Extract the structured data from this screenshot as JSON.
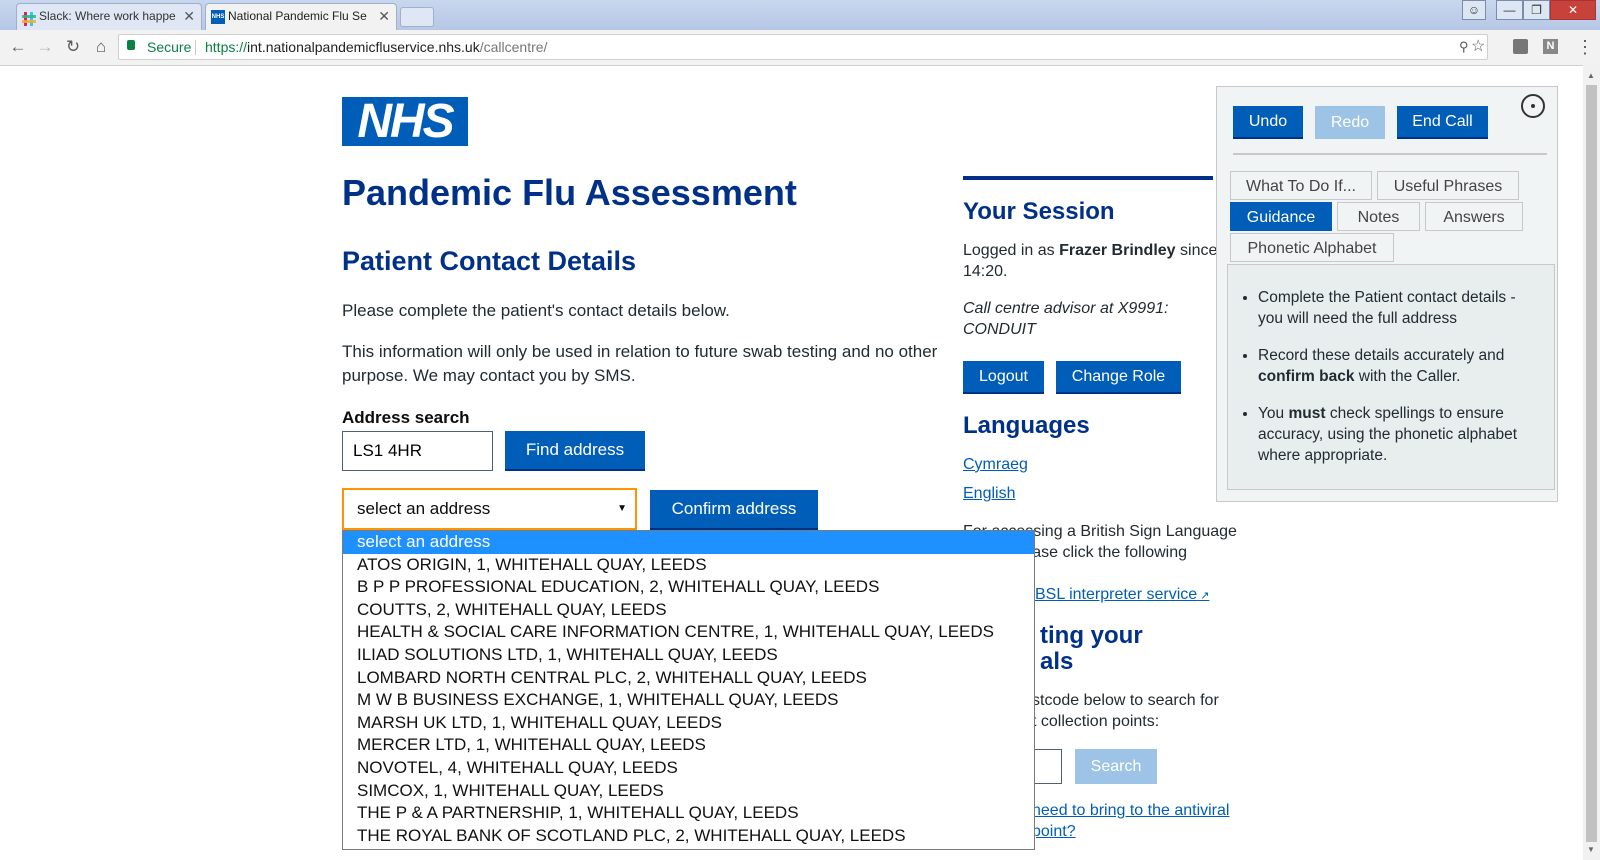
{
  "browser": {
    "tabs": [
      {
        "title": "Slack: Where work happe",
        "active": false
      },
      {
        "title": "National Pandemic Flu Se",
        "active": true
      }
    ],
    "secure_label": "Secure",
    "url_prefix": "https://",
    "url_host": "int.nationalpandemicfluservice.nhs.uk",
    "url_path": "/callcentre/",
    "ext_icon_letter": "N"
  },
  "page": {
    "logo_text": "NHS",
    "title": "Pandemic Flu Assessment",
    "section_title": "Patient Contact Details",
    "intro": "Please complete the patient's contact details below.",
    "info": "This information will only be used in relation to future swab testing and no other purpose. We may contact you by SMS.",
    "address_search_label": "Address search",
    "postcode_value": "LS1 4HR",
    "find_address_label": "Find address",
    "select_value": "select an address",
    "confirm_address_label": "Confirm address",
    "address_options": [
      "select an address",
      "ATOS ORIGIN, 1, WHITEHALL QUAY, LEEDS",
      "B P P PROFESSIONAL EDUCATION, 2, WHITEHALL QUAY, LEEDS",
      "COUTTS, 2, WHITEHALL QUAY, LEEDS",
      "HEALTH & SOCIAL CARE INFORMATION CENTRE, 1, WHITEHALL QUAY, LEEDS",
      "ILIAD SOLUTIONS LTD, 1, WHITEHALL QUAY, LEEDS",
      "LOMBARD NORTH CENTRAL PLC, 2, WHITEHALL QUAY, LEEDS",
      "M W B BUSINESS EXCHANGE, 1, WHITEHALL QUAY, LEEDS",
      "MARSH UK LTD, 1, WHITEHALL QUAY, LEEDS",
      "MERCER LTD, 1, WHITEHALL QUAY, LEEDS",
      "NOVOTEL, 4, WHITEHALL QUAY, LEEDS",
      "SIMCOX, 1, WHITEHALL QUAY, LEEDS",
      "THE P & A PARTNERSHIP, 1, WHITEHALL QUAY, LEEDS",
      "THE ROYAL BANK OF SCOTLAND PLC, 2, WHITEHALL QUAY, LEEDS"
    ]
  },
  "session": {
    "heading": "Your Session",
    "logged_in_prefix": "Logged in as ",
    "user_name": "Frazer Brindley",
    "since_text": " since",
    "since_time": "14:20.",
    "role_line1": "Call centre advisor at X9991:",
    "role_line2": "CONDUIT",
    "logout_label": "Logout",
    "change_role_label": "Change Role"
  },
  "languages": {
    "heading": "Languages",
    "items": [
      "Cymraeg",
      "English"
    ],
    "bsl_text_1": "For accessing a British Sign Language",
    "bsl_text_2": ", please click the following",
    "bsl_link": "BSL interpreter service"
  },
  "collection": {
    "heading_1": "ting your",
    "heading_2": "als",
    "text_1": "stcode below to search for",
    "text_2": "t collection points:",
    "search_label": "Search",
    "link_1": "need to bring to the antiviral",
    "link_2": "point?"
  },
  "call_panel": {
    "undo_label": "Undo",
    "redo_label": "Redo",
    "end_call_label": "End Call",
    "tabs_row1": [
      "What To Do If...",
      "Useful Phrases"
    ],
    "tabs_row2": [
      "Guidance",
      "Notes",
      "Answers"
    ],
    "tabs_row3": [
      "Phonetic Alphabet"
    ],
    "guidance": [
      {
        "pre": "Complete the Patient contact details - you will need the full address",
        "bold": "",
        "post": ""
      },
      {
        "pre": "Record these details accurately and ",
        "bold": "confirm back",
        "post": " with the Caller."
      },
      {
        "pre": "You ",
        "bold": "must",
        "post": " check spellings to ensure accuracy, using the phonetic alphabet where appropriate."
      }
    ]
  },
  "colors": {
    "nhs_blue": "#005eb8",
    "nhs_dark_blue": "#003087",
    "select_highlight": "#1e90ff",
    "focus_orange": "#ff9400"
  }
}
